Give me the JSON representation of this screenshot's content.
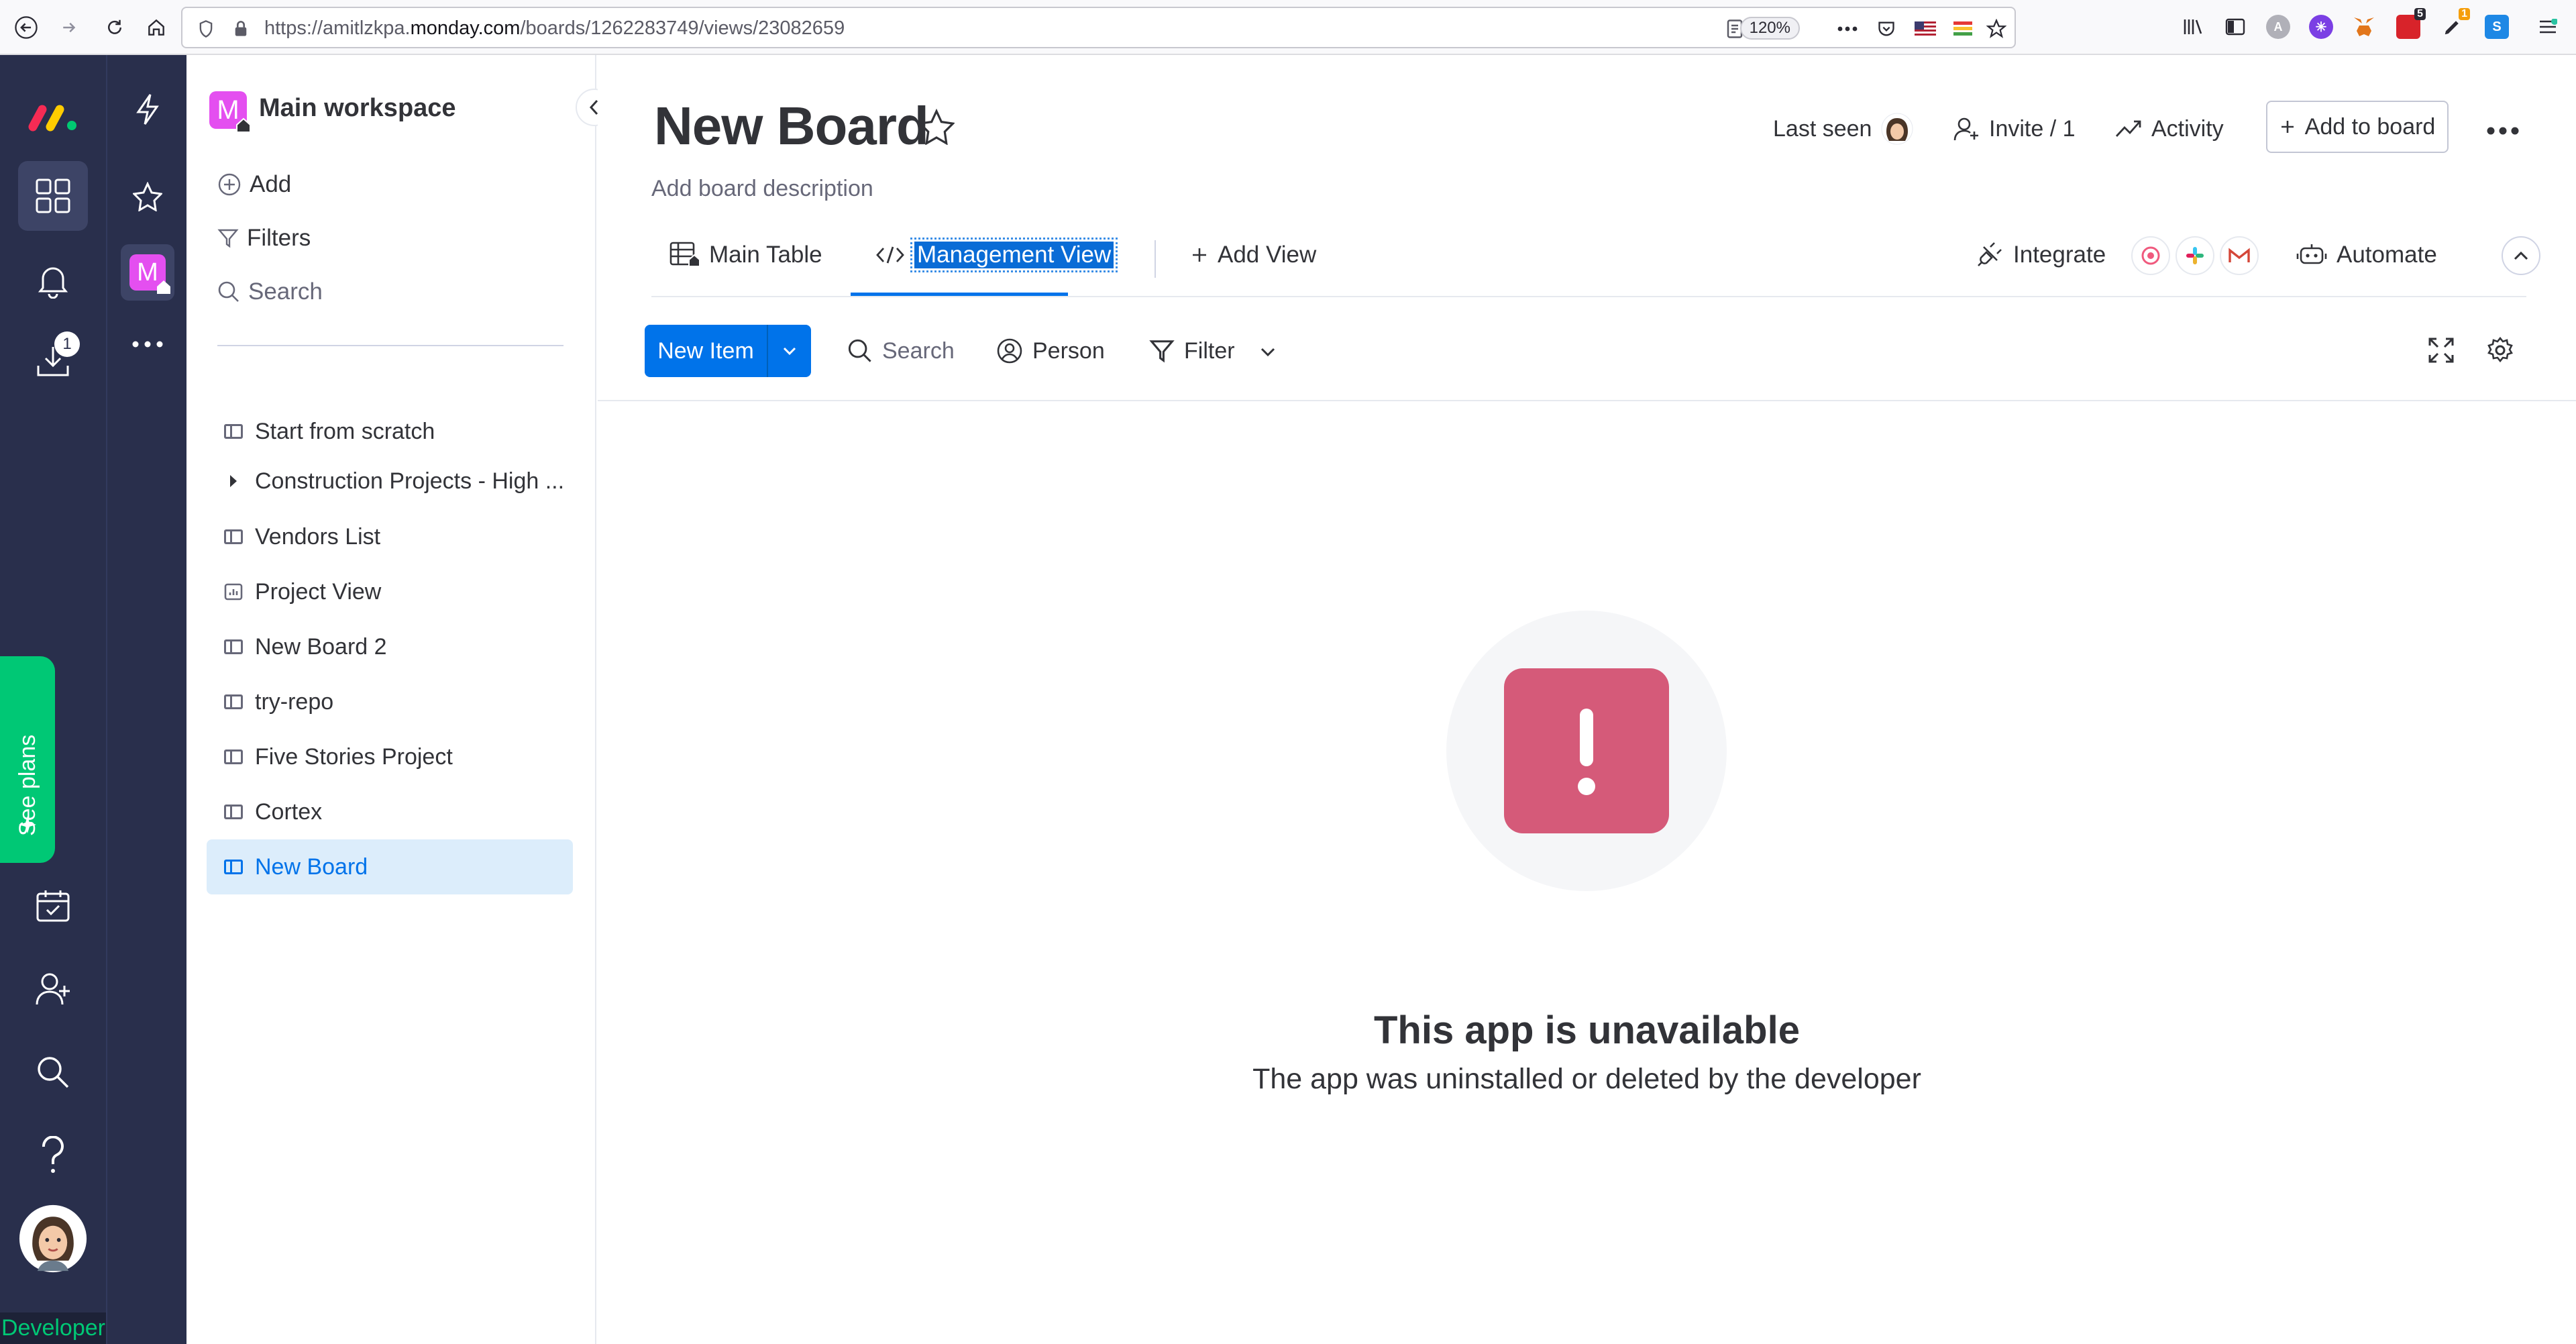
{
  "browser": {
    "url_prefix": "https://amitlzkpa.",
    "url_domain": "monday.com",
    "url_path": "/boards/1262283749/views/23082659",
    "zoom": "120%",
    "ext_badges": [
      "5",
      "1"
    ]
  },
  "rail": {
    "download_badge": "1",
    "see_plans": "See plans",
    "developer": "Developer"
  },
  "workspace": {
    "avatar_letter": "M",
    "name": "Main workspace",
    "add_label": "Add",
    "filters_label": "Filters",
    "search_placeholder": "Search",
    "boards": [
      {
        "label": "Start from scratch",
        "kind": "board"
      },
      {
        "label": "Construction Projects - High ...",
        "kind": "folder"
      },
      {
        "label": "Vendors List",
        "kind": "board"
      },
      {
        "label": "Project View",
        "kind": "dashboard"
      },
      {
        "label": "New Board 2",
        "kind": "board"
      },
      {
        "label": "try-repo",
        "kind": "board"
      },
      {
        "label": "Five Stories Project",
        "kind": "board"
      },
      {
        "label": "Cortex",
        "kind": "board"
      },
      {
        "label": "New Board",
        "kind": "board",
        "active": true
      }
    ]
  },
  "board": {
    "title": "New Board",
    "description_placeholder": "Add board description",
    "last_seen_label": "Last seen",
    "invite_label": "Invite / 1",
    "activity_label": "Activity",
    "add_to_board_label": "Add to board",
    "tabs": {
      "main_table": "Main Table",
      "management_view": "Management View",
      "add_view": "Add View"
    },
    "integrate_label": "Integrate",
    "automate_label": "Automate",
    "toolbar": {
      "new_item": "New Item",
      "search_placeholder": "Search",
      "person": "Person",
      "filter": "Filter"
    }
  },
  "empty_state": {
    "title": "This app is unavailable",
    "subtitle": "The app was uninstalled or deleted by the developer"
  },
  "colors": {
    "brand_blue": "#0073ea",
    "rail_bg": "#292f4c",
    "error_pink": "#d55a79",
    "green": "#00c875"
  }
}
